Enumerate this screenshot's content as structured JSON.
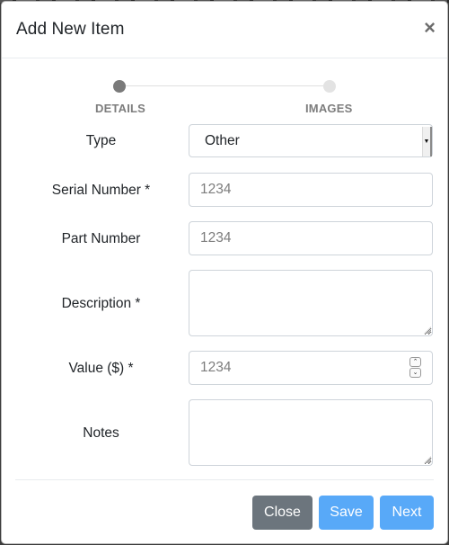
{
  "modal": {
    "title": "Add New Item",
    "close_icon": "close-x-icon"
  },
  "stepper": {
    "steps": [
      {
        "label": "DETAILS",
        "state": "active"
      },
      {
        "label": "IMAGES",
        "state": "inactive"
      }
    ]
  },
  "form": {
    "type": {
      "label": "Type",
      "value": "Other"
    },
    "serial_number": {
      "label": "Serial Number *",
      "placeholder": "1234",
      "value": ""
    },
    "part_number": {
      "label": "Part Number",
      "placeholder": "1234",
      "value": ""
    },
    "description": {
      "label": "Description *",
      "value": ""
    },
    "value": {
      "label": "Value ($) *",
      "placeholder": "1234",
      "value": ""
    },
    "notes": {
      "label": "Notes",
      "value": ""
    }
  },
  "footer": {
    "close_label": "Close",
    "save_label": "Save",
    "next_label": "Next"
  },
  "colors": {
    "primary": "#58a9f8",
    "secondary": "#6c757d",
    "step_active": "#7a7a7a",
    "step_inactive": "#e3e3e3"
  }
}
